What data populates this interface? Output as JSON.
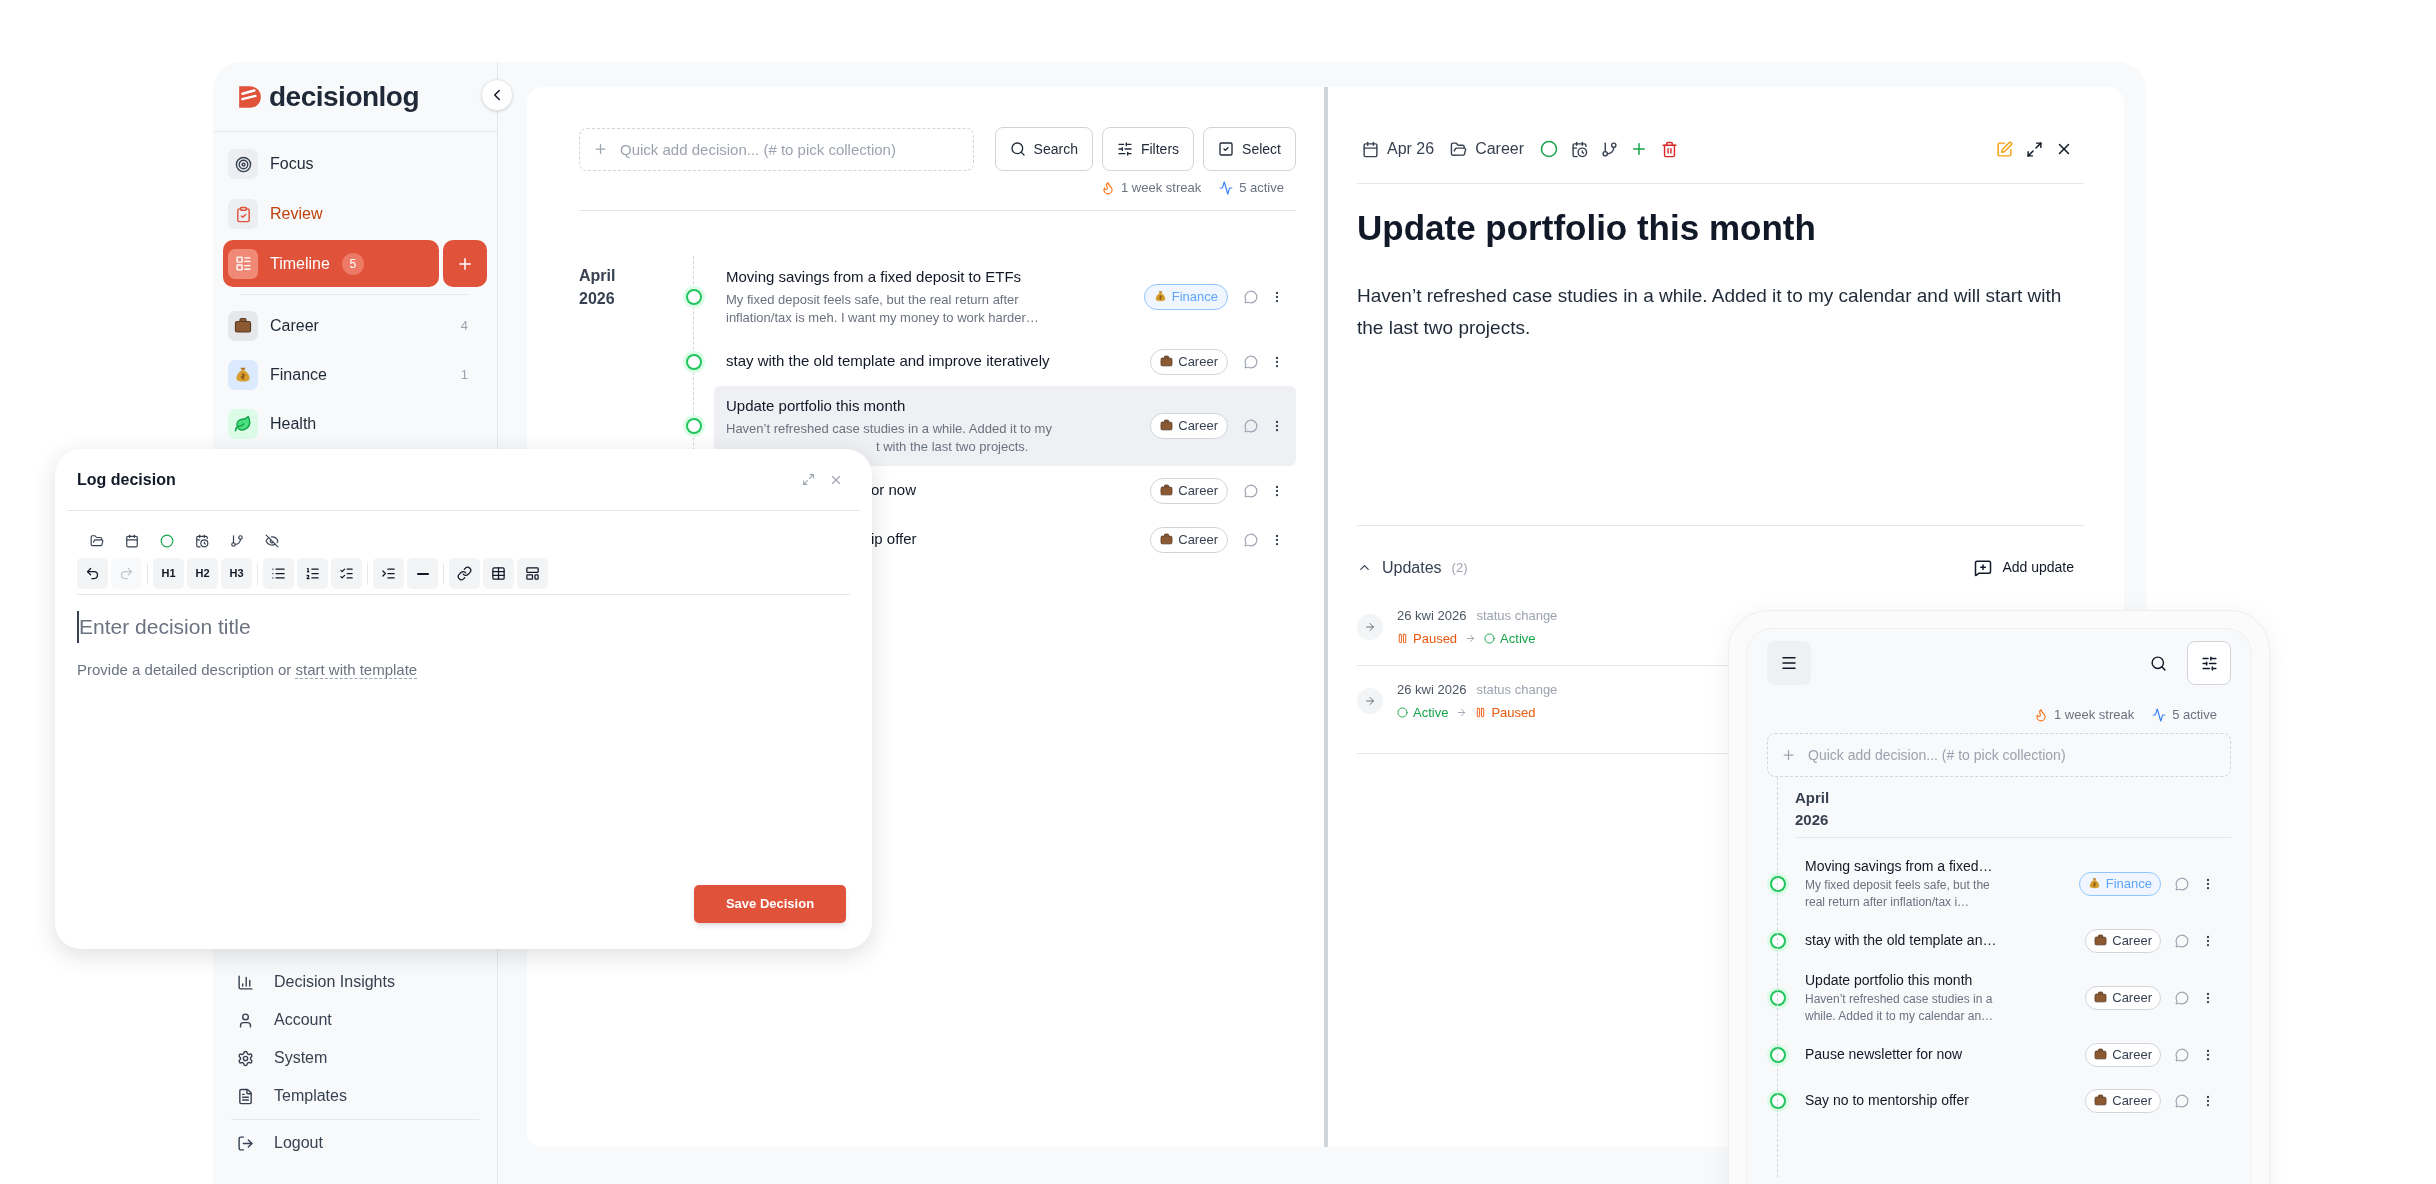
{
  "brand": {
    "name": "decisionlog"
  },
  "sidebar": {
    "nav": [
      {
        "label": "Focus",
        "selected": false,
        "due": false
      },
      {
        "label": "Review",
        "selected": false,
        "due": true
      },
      {
        "label": "Timeline",
        "selected": true,
        "due": false,
        "count": "5"
      }
    ],
    "collections": [
      {
        "label": "Career",
        "count": "4",
        "color": "#e5e7eb"
      },
      {
        "label": "Finance",
        "count": "1",
        "color": "#dbeafe"
      },
      {
        "label": "Health",
        "color": "#dcfce7"
      }
    ],
    "bottom": [
      "Decision Insights",
      "Account",
      "System",
      "Templates"
    ],
    "logout": "Logout"
  },
  "list": {
    "quick_add": {
      "placeholder": "Quick add decision... (# to pick collection)"
    },
    "buttons": [
      "Search",
      "Filters",
      "Select"
    ],
    "stats": {
      "streak": "1 week streak",
      "active": "5 active"
    },
    "group": {
      "month": "April",
      "year": "2026"
    },
    "rows": [
      {
        "kind": "full",
        "title": "Moving savings from a fixed deposit to ETFs",
        "description": "My fixed deposit feels safe, but the real return after inflation/tax is meh. I want my money to work harder…",
        "tag": {
          "label": "Finance",
          "color": "#60a5fa"
        },
        "selected": false
      },
      {
        "kind": "full",
        "title": "stay with the old template and improve iteratively",
        "tag": {
          "label": "Career",
          "color": "#374151"
        },
        "selected": false
      },
      {
        "kind": "tail",
        "title": "Update portfolio this month",
        "description": "Haven’t refreshed case studies in a while. Added it to my",
        "tail": "t with the last two projects.",
        "tag": {
          "label": "Career",
          "color": "#374151"
        },
        "selected": true
      },
      {
        "kind": "cut",
        "title": "or now",
        "tag": {
          "label": "Career",
          "color": "#374151"
        },
        "selected": false
      },
      {
        "kind": "cut",
        "title": "ip offer",
        "tag": {
          "label": "Career",
          "color": "#374151"
        },
        "selected": false
      }
    ]
  },
  "detail": {
    "date": "Apr 26",
    "collection": "Career",
    "title": "Update portfolio this month",
    "body": "Haven’t refreshed case studies in a while. Added it to my calendar and will start with the last two projects.",
    "updates": {
      "label": "Updates",
      "count": "(2)",
      "expanded": true,
      "add": "Add update",
      "items": [
        {
          "date": "26 kwi 2026",
          "type": "status change",
          "from": {
            "label": "Paused",
            "kind": "paused"
          },
          "to": {
            "label": "Active",
            "kind": "active"
          }
        },
        {
          "date": "26 kwi 2026",
          "type": "status change",
          "from": {
            "label": "Active",
            "kind": "active"
          },
          "to": {
            "label": "Paused",
            "kind": "paused"
          }
        }
      ]
    }
  },
  "dialog": {
    "title": "Log decision",
    "undo": {
      "disabled": false
    },
    "redo": {
      "disabled": true
    },
    "headings": [
      "H1",
      "H2",
      "H3"
    ],
    "title_placeholder": "Enter decision title",
    "description_placeholder": "Provide a detailed description or",
    "template_link": "start with template",
    "save": "Save Decision"
  },
  "mobile": {
    "stats": {
      "streak": "1 week streak",
      "active": "5 active"
    },
    "quick_add": {
      "placeholder": "Quick add decision... (# to pick collection)"
    },
    "group": {
      "month": "April",
      "year": "2026"
    },
    "rows": [
      {
        "title": "Moving savings from a fixed…",
        "description": "My fixed deposit feels safe, but the real return after inflation/tax i…",
        "tag": {
          "label": "Finance",
          "color": "#60a5fa"
        }
      },
      {
        "title": "stay with the old template an…",
        "tag": {
          "label": "Career",
          "color": "#374151"
        }
      },
      {
        "title": "Update portfolio this month",
        "description": "Haven’t refreshed case studies in a while. Added it to my calendar an…",
        "tag": {
          "label": "Career",
          "color": "#374151"
        }
      },
      {
        "title": "Pause newsletter for now",
        "tag": {
          "label": "Career",
          "color": "#374151"
        }
      },
      {
        "title": "Say no to mentorship offer",
        "tag": {
          "label": "Career",
          "color": "#374151"
        }
      }
    ]
  }
}
